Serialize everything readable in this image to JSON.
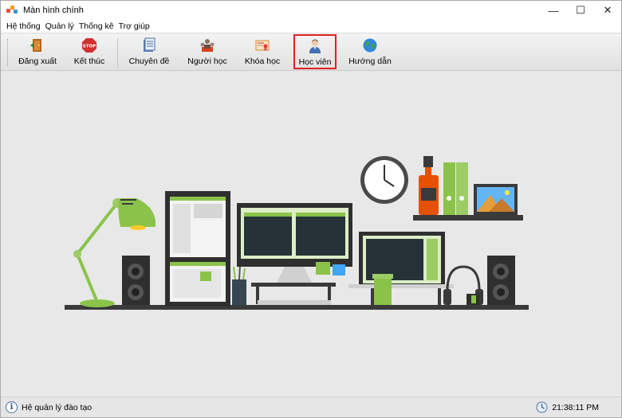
{
  "window": {
    "title": "Màn hình chính",
    "controls": {
      "minimize": "—",
      "maximize": "☐",
      "close": "✕"
    }
  },
  "menubar": {
    "items": [
      "Hệ thống",
      "Quản lý",
      "Thống kê",
      "Trợ giúp"
    ]
  },
  "toolbar": {
    "selected": "hoc-vien",
    "buttons": [
      {
        "id": "dang-xuat",
        "label": "Đăng xuất",
        "icon": "door-exit-icon"
      },
      {
        "id": "ket-thuc",
        "label": "Kết thúc",
        "icon": "stop-sign-icon"
      },
      {
        "id": "chuyen-de",
        "label": "Chuyên đề",
        "icon": "document-icon"
      },
      {
        "id": "nguoi-hoc",
        "label": "Người học",
        "icon": "group-icon"
      },
      {
        "id": "khoa-hoc",
        "label": "Khóa học",
        "icon": "certificate-icon"
      },
      {
        "id": "hoc-vien",
        "label": "Học viên",
        "icon": "user-icon"
      },
      {
        "id": "huong-dan",
        "label": "Hướng dẫn",
        "icon": "globe-icon"
      }
    ]
  },
  "illustration": {
    "name": "office-desk-illustration"
  },
  "status": {
    "left_text": "Hệ quản lý đào tạo",
    "time": "21:38:11 PM"
  },
  "colors": {
    "accent_green": "#8bc34a",
    "dark": "#333333",
    "selected_border": "#e02020",
    "background": "#e8e8e8"
  }
}
